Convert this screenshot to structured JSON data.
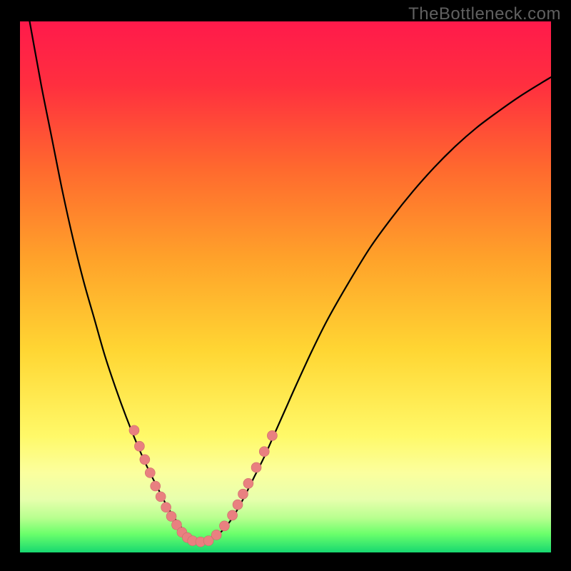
{
  "watermark": "TheBottleneck.com",
  "colors": {
    "frame": "#000000",
    "gradient_stops": [
      {
        "offset": 0.0,
        "color": "#ff1a4b"
      },
      {
        "offset": 0.12,
        "color": "#ff2f3f"
      },
      {
        "offset": 0.28,
        "color": "#ff6a2e"
      },
      {
        "offset": 0.45,
        "color": "#ffa32a"
      },
      {
        "offset": 0.62,
        "color": "#ffd633"
      },
      {
        "offset": 0.78,
        "color": "#fff968"
      },
      {
        "offset": 0.85,
        "color": "#fbff9e"
      },
      {
        "offset": 0.9,
        "color": "#e7ffad"
      },
      {
        "offset": 0.935,
        "color": "#b8ff8f"
      },
      {
        "offset": 0.965,
        "color": "#6bff6b"
      },
      {
        "offset": 1.0,
        "color": "#17d870"
      }
    ],
    "curve": "#000000",
    "marker_fill": "#e98080",
    "marker_stroke": "#cc6a6a"
  },
  "chart_data": {
    "type": "line",
    "title": "",
    "xlabel": "",
    "ylabel": "",
    "xlim": [
      0,
      100
    ],
    "ylim": [
      0,
      100
    ],
    "series": [
      {
        "name": "bottleneck-curve",
        "x": [
          0,
          2,
          4,
          6,
          8,
          10,
          12,
          14,
          16,
          18,
          20,
          22,
          24,
          26,
          27,
          28,
          29,
          30,
          31,
          32,
          33,
          34,
          36,
          38,
          40,
          42,
          44,
          46,
          48,
          50,
          52,
          55,
          58,
          62,
          66,
          70,
          74,
          78,
          82,
          86,
          90,
          94,
          98,
          100
        ],
        "values": [
          110,
          99,
          88,
          78,
          68,
          59,
          51,
          44,
          37,
          31,
          25.5,
          20.5,
          16,
          12,
          10,
          8.2,
          6.6,
          5.2,
          4,
          3,
          2.2,
          2,
          2.5,
          4,
          6.5,
          10,
          14,
          18,
          22.5,
          27,
          31.5,
          38,
          44,
          51,
          57.5,
          63,
          68,
          72.5,
          76.5,
          80,
          83,
          85.8,
          88.3,
          89.5
        ]
      }
    ],
    "markers": [
      {
        "x": 21.5,
        "y": 23
      },
      {
        "x": 22.5,
        "y": 20
      },
      {
        "x": 23.5,
        "y": 17.5
      },
      {
        "x": 24.5,
        "y": 15
      },
      {
        "x": 25.5,
        "y": 12.5
      },
      {
        "x": 26.5,
        "y": 10.5
      },
      {
        "x": 27.5,
        "y": 8.5
      },
      {
        "x": 28.5,
        "y": 6.8
      },
      {
        "x": 29.5,
        "y": 5.2
      },
      {
        "x": 30.5,
        "y": 3.8
      },
      {
        "x": 31.5,
        "y": 2.8
      },
      {
        "x": 32.5,
        "y": 2.2
      },
      {
        "x": 34,
        "y": 2
      },
      {
        "x": 35.5,
        "y": 2.2
      },
      {
        "x": 37,
        "y": 3.3
      },
      {
        "x": 38.5,
        "y": 5
      },
      {
        "x": 40,
        "y": 7
      },
      {
        "x": 41,
        "y": 9
      },
      {
        "x": 42,
        "y": 11
      },
      {
        "x": 43,
        "y": 13
      },
      {
        "x": 44.5,
        "y": 16
      },
      {
        "x": 46,
        "y": 19
      },
      {
        "x": 47.5,
        "y": 22
      }
    ]
  }
}
